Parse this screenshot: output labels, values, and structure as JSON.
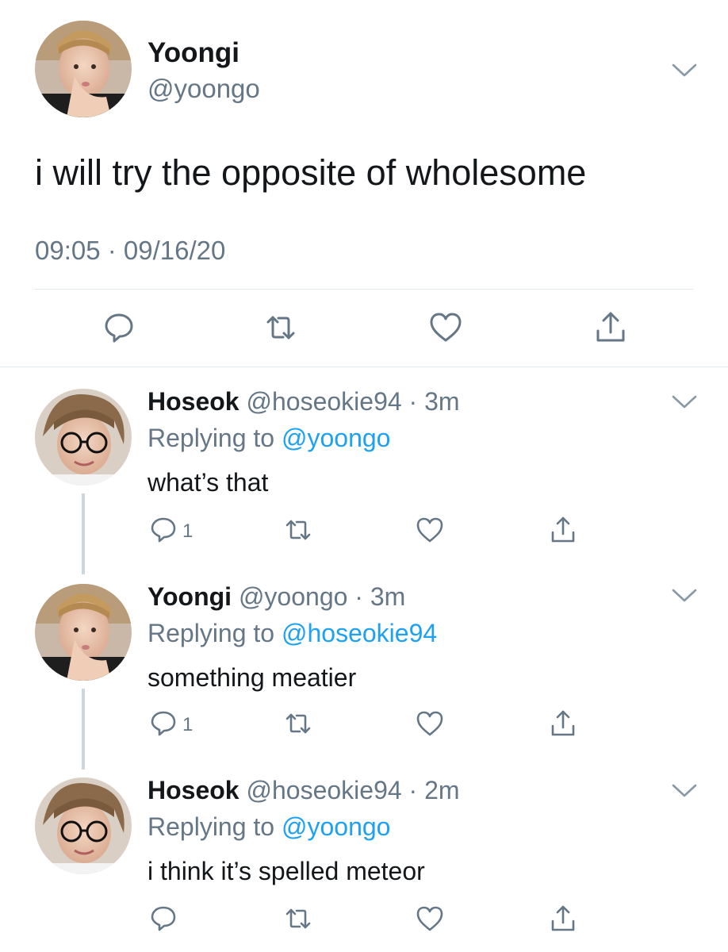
{
  "main_tweet": {
    "name": "Yoongi",
    "handle": "@yoongo",
    "text": "i will try the opposite of wholesome",
    "timestamp": "09:05 · 09/16/20",
    "actions": [
      "comment-icon",
      "retweet-icon",
      "like-icon",
      "share-icon"
    ]
  },
  "replies": [
    {
      "name": "Hoseok",
      "handle": "@hoseokie94",
      "separator": "·",
      "time": "3m",
      "replying_prefix": "Replying to ",
      "replying_to": "@yoongo",
      "text": "what’s that",
      "reply_count": "1"
    },
    {
      "name": "Yoongi",
      "handle": "@yoongo",
      "separator": "·",
      "time": "3m",
      "replying_prefix": "Replying to ",
      "replying_to": "@hoseokie94",
      "text": "something meatier",
      "reply_count": "1"
    },
    {
      "name": "Hoseok",
      "handle": "@hoseokie94",
      "separator": "·",
      "time": "2m",
      "replying_prefix": "Replying to ",
      "replying_to": "@yoongo",
      "text": "i think it’s spelled meteor",
      "reply_count": ""
    }
  ],
  "colors": {
    "text": "#14171a",
    "secondary": "#657786",
    "link": "#1da1f2",
    "divider": "#e1e8ed"
  }
}
